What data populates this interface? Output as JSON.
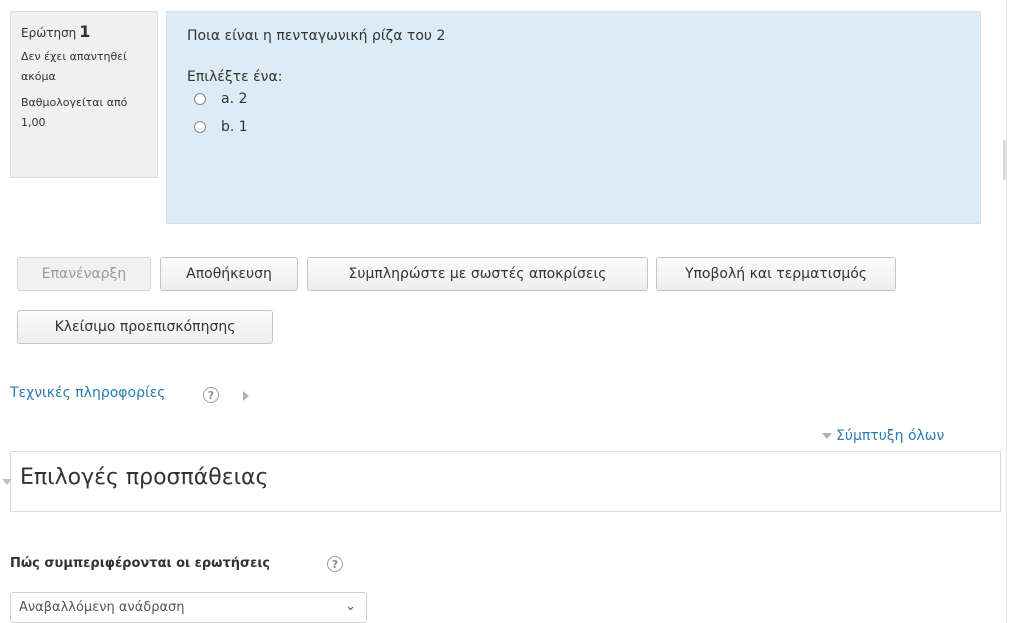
{
  "question": {
    "label": "Ερώτηση",
    "number": "1",
    "state": "Δεν έχει απαντηθεί ακόμα",
    "grade": "Βαθμολογείται από 1,00",
    "text": "Ποια είναι η πενταγωνική ρίζα του 2",
    "prompt": "Επιλέξτε ένα:",
    "answers": [
      {
        "label": "a. 2"
      },
      {
        "label": "b. 1"
      }
    ]
  },
  "buttons": {
    "restart": "Επανέναρξη",
    "save": "Αποθήκευση",
    "fill_correct": "Συμπληρώστε με σωστές αποκρίσεις",
    "submit_finish": "Υποβολή και τερματισμός",
    "close_preview": "Κλείσιμο προεπισκόπησης"
  },
  "tech_info": {
    "label": "Τεχνικές πληροφορίες",
    "help_symbol": "?"
  },
  "collapse_all": "Σύμπτυξη όλων",
  "section": {
    "title": "Επιλογές προσπάθειας"
  },
  "behaviour": {
    "label": "Πώς συμπεριφέρονται οι ερωτήσεις",
    "help_symbol": "?",
    "selected": "Αναβαλλόμενη ανάδραση",
    "chevron": "⌄"
  },
  "colors": {
    "content_bg": "#dcebf5",
    "info_bg": "#f0f0f0",
    "link": "#2a7bb4"
  }
}
